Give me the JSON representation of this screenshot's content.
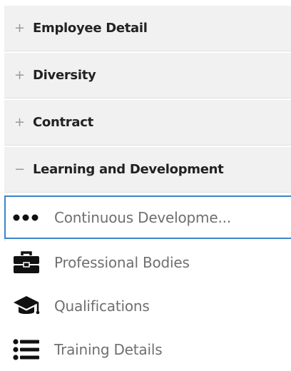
{
  "sections": [
    {
      "sign": "+",
      "label": "Employee Detail"
    },
    {
      "sign": "+",
      "label": "Diversity"
    },
    {
      "sign": "+",
      "label": "Contract"
    },
    {
      "sign": "−",
      "label": "Learning and Development"
    }
  ],
  "subitems": [
    {
      "icon": "ellipsis-icon",
      "label": "Continuous Developme..."
    },
    {
      "icon": "briefcase-icon",
      "label": "Professional Bodies"
    },
    {
      "icon": "graduation-cap-icon",
      "label": "Qualifications"
    },
    {
      "icon": "list-icon",
      "label": "Training Details"
    }
  ],
  "colors": {
    "section_bg": "#f1f1f1",
    "selected_border": "#3a86c8",
    "sub_text": "#6f6f6f",
    "section_text": "#222222"
  }
}
